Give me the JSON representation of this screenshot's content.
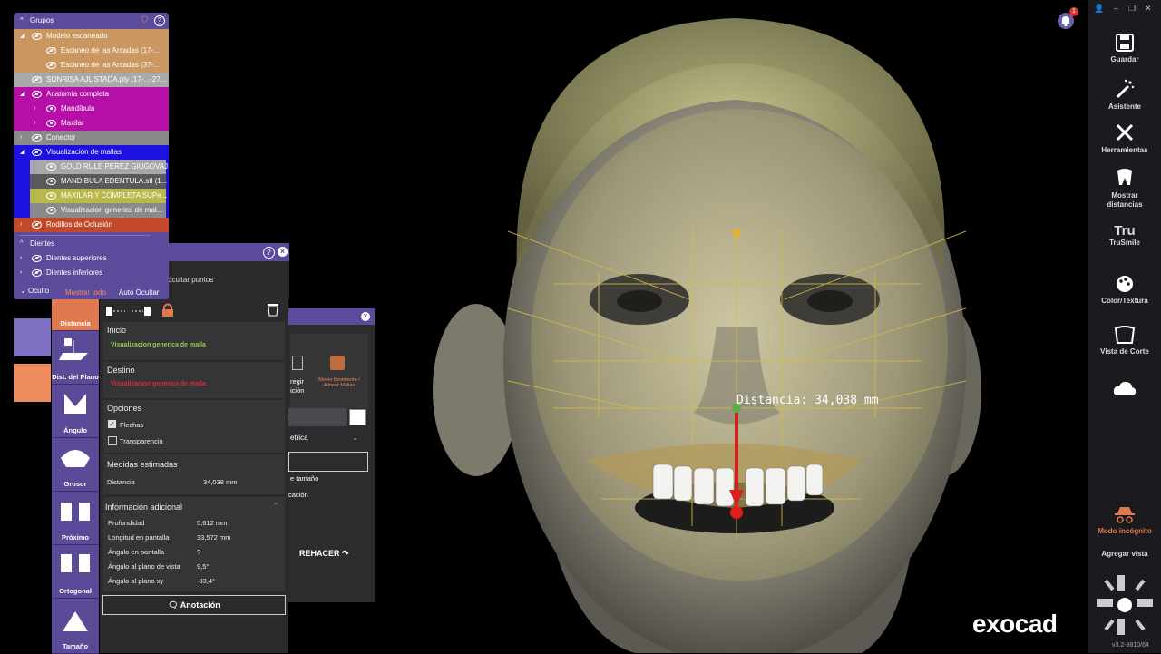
{
  "groups": {
    "title": "Grupos",
    "rows": [
      {
        "label": "Modelo escaneado",
        "arrow": "◢"
      },
      {
        "label": "Escaneo de las Arcadas (17-..."
      },
      {
        "label": "Escaneo de las Arcadas (37-..."
      },
      {
        "label": "SONRISA AJUSTADA.ply (17-...-27..."
      },
      {
        "label": "Anatomía completa",
        "arrow": "◢"
      },
      {
        "label": "Mandíbula",
        "arrow": "›"
      },
      {
        "label": "Maxilar",
        "arrow": "›"
      },
      {
        "label": "Conector",
        "arrow": "›"
      },
      {
        "label": "Visualización de mallas",
        "arrow": "◢"
      },
      {
        "label": "GOLD RULE PEREZ GIUGOVAJ..."
      },
      {
        "label": "MANDIBULA EDENTULA.stl (1..."
      },
      {
        "label": "MAXILAR Y COMPLETA SUPe..."
      },
      {
        "label": "Visualizacion generica de mal..."
      },
      {
        "label": "Rodillos de Oclusión",
        "arrow": "›"
      },
      {
        "label": "Dientes",
        "arrow": "^"
      },
      {
        "label": "Dientes superiores",
        "arrow": "›"
      },
      {
        "label": "Dientes inferiores",
        "arrow": "›"
      }
    ],
    "hidden_label": "Oculto",
    "show_all": "Mostrar todo",
    "auto_hide": "Auto Ocultar",
    "colors": {
      "orange": "#c9975f",
      "magenta": "#b60fa8",
      "grey": "#8a8a8a",
      "blue": "#1c11e0",
      "yellow": "#b9b84a",
      "red": "#c24a2a",
      "purple": "#5b4b9a"
    }
  },
  "hidden_header": "ocultar puntos",
  "tools": [
    {
      "label": "Distancia"
    },
    {
      "label": "Dist. del Plano"
    },
    {
      "label": "Ángulo"
    },
    {
      "label": "Grosor"
    },
    {
      "label": "Próximo"
    },
    {
      "label": "Ortogonal"
    },
    {
      "label": "Tamaño"
    }
  ],
  "measure": {
    "start_title": "Inicio",
    "start_value": "Visualizacion generica de malla",
    "dest_title": "Destino",
    "dest_value": "Visualizacion generica de malla",
    "options_title": "Opciones",
    "opt_arrows": "Flechas",
    "opt_transparency": "Transparencia",
    "estimated_title": "Medidas estimadas",
    "distance_label": "Distancia",
    "distance_value": "34,038 mm",
    "additional_title": "Información adicional",
    "depth_label": "Profundidad",
    "depth_value": "5,612 mm",
    "screen_len_label": "Longitud en pantalla",
    "screen_len_value": "33,572 mm",
    "screen_angle_label": "Ángulo en pantalla",
    "screen_angle_value": "?",
    "view_angle_label": "Ángulo al plano de vista",
    "view_angle_value": "9,5°",
    "xy_angle_label": "Ángulo al plano xy",
    "xy_angle_value": "-83,4°",
    "annotation_btn": "Anotación"
  },
  "panel2": {
    "correct": "regir ición",
    "move_label": "Mover libremente / Alinear Mallas",
    "metric": "etrica",
    "size": "e tamaño",
    "cation": "cación",
    "redo": "REHACER"
  },
  "viewport": {
    "distance_readout": "Distancia: 34,038 mm",
    "brand": "exocad"
  },
  "right_bar": {
    "items": [
      {
        "label": "Guardar"
      },
      {
        "label": "Asistente"
      },
      {
        "label": "Herramientas"
      },
      {
        "label": "Mostrar distancias"
      },
      {
        "label": "TruSmile"
      },
      {
        "label": "Color/Textura"
      },
      {
        "label": "Vista de Corte"
      },
      {
        "label": "Modo incógnito"
      },
      {
        "label": "Agregar vista"
      }
    ],
    "notification_count": "1",
    "version": "v3.2-8810/64"
  }
}
